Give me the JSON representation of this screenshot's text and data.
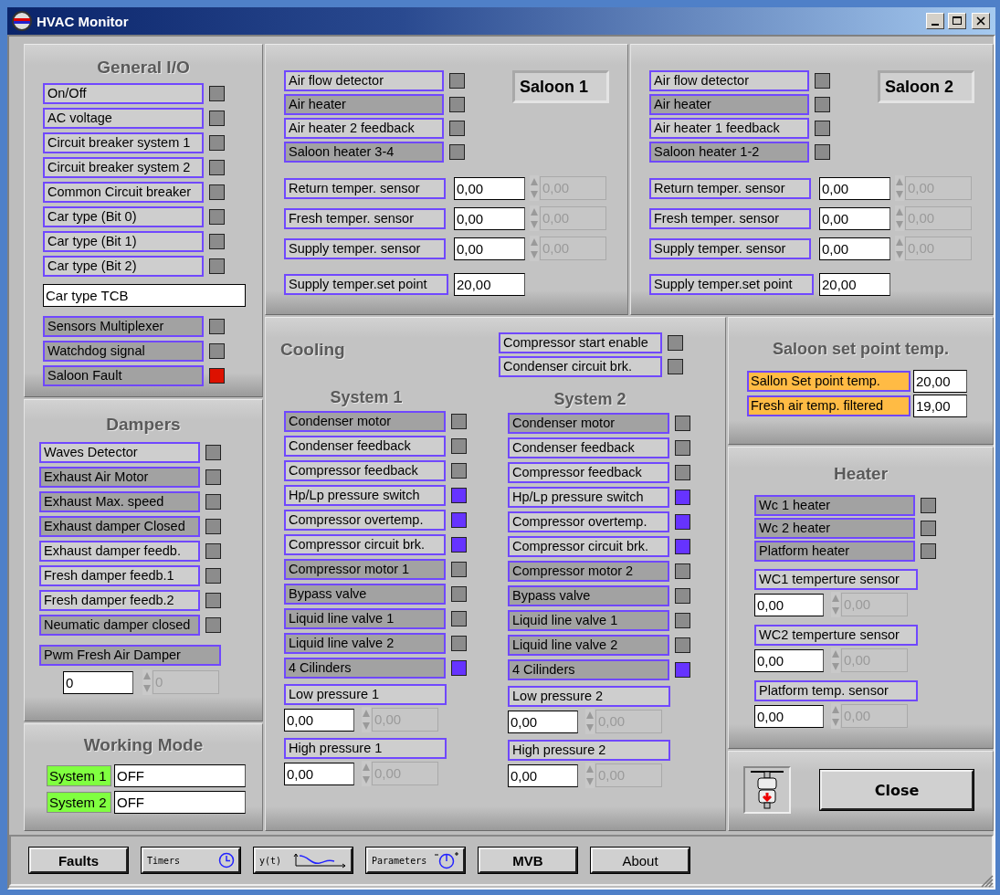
{
  "window": {
    "title": "HVAC Monitor"
  },
  "general_io": {
    "title": "General I/O",
    "items": [
      {
        "kind": "indicator",
        "label": "On/Off",
        "shaded": false,
        "color": "#8c8c8c"
      },
      {
        "kind": "indicator",
        "label": "AC voltage",
        "shaded": false,
        "color": "#8c8c8c"
      },
      {
        "kind": "indicator",
        "label": "Circuit breaker system 1",
        "shaded": false,
        "color": "#8c8c8c"
      },
      {
        "kind": "indicator",
        "label": "Circuit breaker system 2",
        "shaded": false,
        "color": "#8c8c8c"
      },
      {
        "kind": "indicator",
        "label": "Common Circuit breaker",
        "shaded": false,
        "color": "#8c8c8c"
      },
      {
        "kind": "indicator",
        "label": "Car type (Bit 0)",
        "shaded": false,
        "color": "#8c8c8c"
      },
      {
        "kind": "indicator",
        "label": "Car type (Bit 1)",
        "shaded": false,
        "color": "#8c8c8c"
      },
      {
        "kind": "indicator",
        "label": "Car type (Bit 2)",
        "shaded": false,
        "color": "#8c8c8c"
      },
      {
        "kind": "display",
        "value": "Car type TCB"
      },
      {
        "kind": "indicator",
        "label": "Sensors Multiplexer",
        "shaded": true,
        "color": "#8c8c8c"
      },
      {
        "kind": "indicator",
        "label": "Watchdog signal",
        "shaded": true,
        "color": "#8c8c8c"
      },
      {
        "kind": "indicator",
        "label": "Saloon Fault",
        "shaded": true,
        "color": "#dd1100"
      }
    ]
  },
  "saloons": [
    {
      "title": "Saloon 1",
      "indicators": [
        {
          "label": "Air flow detector",
          "shaded": false,
          "color": "#8c8c8c"
        },
        {
          "label": "Air heater",
          "shaded": true,
          "color": "#8c8c8c"
        },
        {
          "label": "Air heater 2 feedback",
          "shaded": false,
          "color": "#8c8c8c"
        },
        {
          "label": "Saloon heater 3-4",
          "shaded": true,
          "color": "#8c8c8c"
        }
      ],
      "sensors": [
        {
          "label": "Return temper. sensor",
          "value": "0,00",
          "spin": "0,00"
        },
        {
          "label": "Fresh temper. sensor",
          "value": "0,00",
          "spin": "0,00"
        },
        {
          "label": "Supply temper. sensor",
          "value": "0,00",
          "spin": "0,00"
        }
      ],
      "set_point": {
        "label": "Supply temper.set point",
        "value": "20,00"
      }
    },
    {
      "title": "Saloon 2",
      "indicators": [
        {
          "label": "Air flow detector",
          "shaded": false,
          "color": "#8c8c8c"
        },
        {
          "label": "Air heater",
          "shaded": true,
          "color": "#8c8c8c"
        },
        {
          "label": "Air heater 1 feedback",
          "shaded": false,
          "color": "#8c8c8c"
        },
        {
          "label": "Saloon heater 1-2",
          "shaded": true,
          "color": "#8c8c8c"
        }
      ],
      "sensors": [
        {
          "label": "Return temper. sensor",
          "value": "0,00",
          "spin": "0,00"
        },
        {
          "label": "Fresh temper. sensor",
          "value": "0,00",
          "spin": "0,00"
        },
        {
          "label": "Supply temper. sensor",
          "value": "0,00",
          "spin": "0,00"
        }
      ],
      "set_point": {
        "label": "Supply temper.set point",
        "value": "20,00"
      }
    }
  ],
  "dampers": {
    "title": "Dampers",
    "indicators": [
      {
        "label": "Waves Detector",
        "shaded": false,
        "color": "#8c8c8c"
      },
      {
        "label": "Exhaust Air Motor",
        "shaded": true,
        "color": "#8c8c8c"
      },
      {
        "label": "Exhaust Max. speed",
        "shaded": true,
        "color": "#8c8c8c"
      },
      {
        "label": "Exhaust damper Closed",
        "shaded": true,
        "color": "#8c8c8c"
      },
      {
        "label": "Exhaust damper feedb.",
        "shaded": false,
        "color": "#8c8c8c"
      },
      {
        "label": "Fresh damper feedb.1",
        "shaded": false,
        "color": "#8c8c8c"
      },
      {
        "label": "Fresh damper feedb.2",
        "shaded": false,
        "color": "#8c8c8c"
      },
      {
        "label": "Neumatic damper closed",
        "shaded": true,
        "color": "#8c8c8c"
      }
    ],
    "pwm": {
      "label": "Pwm Fresh Air Damper",
      "shaded": true,
      "value": "0",
      "spin": "0"
    }
  },
  "working_mode": {
    "title": "Working Mode",
    "rows": [
      {
        "label": "System 1",
        "value": "OFF"
      },
      {
        "label": "System 2",
        "value": "OFF"
      }
    ]
  },
  "cooling": {
    "title": "Cooling",
    "indicators": [
      {
        "label": "Compressor start enable",
        "shaded": false,
        "color": "#8c8c8c"
      },
      {
        "label": "Condenser circuit brk.",
        "shaded": false,
        "color": "#8c8c8c"
      }
    ],
    "systems": [
      {
        "title": "System 1",
        "indicators": [
          {
            "label": "Condenser motor",
            "shaded": true,
            "color": "#8c8c8c"
          },
          {
            "label": "Condenser feedback",
            "shaded": false,
            "color": "#8c8c8c"
          },
          {
            "label": "Compressor feedback",
            "shaded": false,
            "color": "#8c8c8c"
          },
          {
            "label": "Hp/Lp pressure switch",
            "shaded": false,
            "color": "#6633ff"
          },
          {
            "label": "Compressor overtemp.",
            "shaded": false,
            "color": "#6633ff"
          },
          {
            "label": "Compressor circuit brk.",
            "shaded": false,
            "color": "#6633ff"
          },
          {
            "label": "Compressor motor 1",
            "shaded": true,
            "color": "#8c8c8c"
          },
          {
            "label": "Bypass valve",
            "shaded": true,
            "color": "#8c8c8c"
          },
          {
            "label": "Liquid line valve 1",
            "shaded": true,
            "color": "#8c8c8c"
          },
          {
            "label": "Liquid line valve 2",
            "shaded": true,
            "color": "#8c8c8c"
          },
          {
            "label": "4 Cilinders",
            "shaded": true,
            "color": "#6633ff"
          }
        ],
        "pressures": [
          {
            "label": "Low pressure 1",
            "value": "0,00",
            "spin": "0,00"
          },
          {
            "label": "High pressure 1",
            "value": "0,00",
            "spin": "0,00"
          }
        ]
      },
      {
        "title": "System 2",
        "indicators": [
          {
            "label": "Condenser motor",
            "shaded": true,
            "color": "#8c8c8c"
          },
          {
            "label": "Condenser feedback",
            "shaded": false,
            "color": "#8c8c8c"
          },
          {
            "label": "Compressor feedback",
            "shaded": false,
            "color": "#8c8c8c"
          },
          {
            "label": "Hp/Lp pressure switch",
            "shaded": false,
            "color": "#6633ff"
          },
          {
            "label": "Compressor overtemp.",
            "shaded": false,
            "color": "#6633ff"
          },
          {
            "label": "Compressor circuit brk.",
            "shaded": false,
            "color": "#6633ff"
          },
          {
            "label": "Compressor motor 2",
            "shaded": true,
            "color": "#8c8c8c"
          },
          {
            "label": "Bypass valve",
            "shaded": true,
            "color": "#8c8c8c"
          },
          {
            "label": "Liquid line valve 1",
            "shaded": true,
            "color": "#8c8c8c"
          },
          {
            "label": "Liquid line valve 2",
            "shaded": true,
            "color": "#8c8c8c"
          },
          {
            "label": "4 Cilinders",
            "shaded": true,
            "color": "#6633ff"
          }
        ],
        "pressures": [
          {
            "label": "Low pressure 2",
            "value": "0,00",
            "spin": "0,00"
          },
          {
            "label": "High pressure 2",
            "value": "0,00",
            "spin": "0,00"
          }
        ]
      }
    ]
  },
  "set_point_temp": {
    "title": "Saloon set point temp.",
    "rows": [
      {
        "label": "Sallon Set point temp.",
        "value": "20,00"
      },
      {
        "label": "Fresh air temp. filtered",
        "value": "19,00"
      }
    ]
  },
  "heater": {
    "title": "Heater",
    "indicators": [
      {
        "label": "Wc 1 heater",
        "shaded": true,
        "color": "#8c8c8c"
      },
      {
        "label": "Wc 2 heater",
        "shaded": true,
        "color": "#8c8c8c"
      },
      {
        "label": "Platform heater",
        "shaded": true,
        "color": "#8c8c8c"
      }
    ],
    "sensors": [
      {
        "label": "WC1 temperture sensor",
        "value": "0,00",
        "spin": "0,00"
      },
      {
        "label": "WC2 temperture sensor",
        "value": "0,00",
        "spin": "0,00"
      },
      {
        "label": "Platform temp. sensor",
        "value": "0,00",
        "spin": "0,00"
      }
    ]
  },
  "close_button": {
    "label": "Close"
  },
  "toolbar": [
    {
      "label": "Faults",
      "kind": "bold"
    },
    {
      "label": "Timers",
      "kind": "clock"
    },
    {
      "label": "y(t)",
      "kind": "trend"
    },
    {
      "label": "Parameters",
      "kind": "gauge"
    },
    {
      "label": "MVB",
      "kind": "bold"
    },
    {
      "label": "About",
      "kind": "plain"
    }
  ]
}
